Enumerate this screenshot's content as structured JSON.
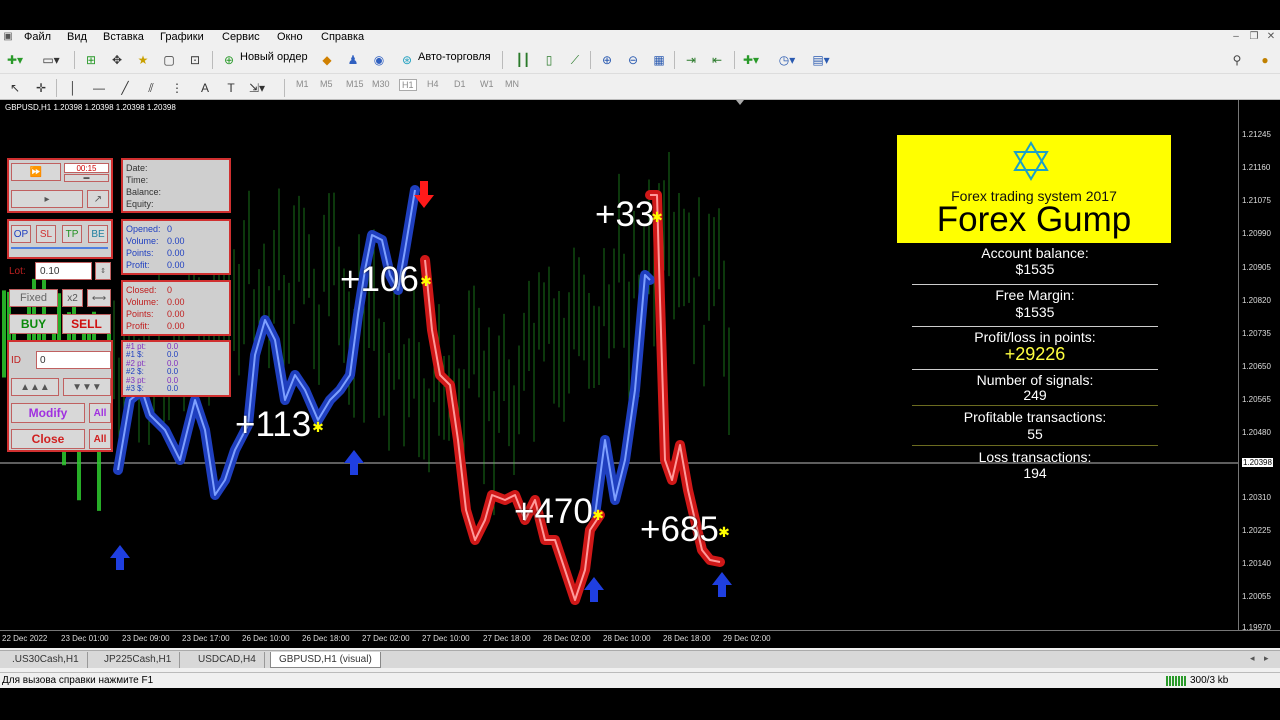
{
  "menu": [
    "Файл",
    "Вид",
    "Вставка",
    "Графики",
    "Сервис",
    "Окно",
    "Справка"
  ],
  "toolbar": {
    "new_order": "Новый ордер",
    "auto_trading": "Авто-торговля",
    "timeframes": [
      "M1",
      "M5",
      "M15",
      "M30",
      "H1",
      "H4",
      "D1",
      "W1",
      "MN"
    ]
  },
  "chart": {
    "header": "GBPUSD,H1  1.20398 1.20398 1.20398 1.20398",
    "price_scale": [
      "1.21245",
      "1.21160",
      "1.21075",
      "1.20990",
      "1.20905",
      "1.20820",
      "1.20735",
      "1.20650",
      "1.20565",
      "1.20480",
      "1.20398",
      "1.20310",
      "1.20225",
      "1.20140",
      "1.20055",
      "1.19970"
    ],
    "current_price": "1.20398",
    "time_labels": [
      "22 Dec 2022",
      "23 Dec 01:00",
      "23 Dec 09:00",
      "23 Dec 17:00",
      "26 Dec 10:00",
      "26 Dec 18:00",
      "27 Dec 02:00",
      "27 Dec 10:00",
      "27 Dec 18:00",
      "28 Dec 02:00",
      "28 Dec 10:00",
      "28 Dec 18:00",
      "29 Dec 02:00"
    ],
    "profit_labels": [
      "+106",
      "+113",
      "+33",
      "+470",
      "+685"
    ]
  },
  "panel": {
    "speed": "00:15",
    "info_labels": [
      "Date:",
      "Time:",
      "Balance:",
      "Equity:"
    ],
    "op_buttons": [
      "OP",
      "SL",
      "TP",
      "BE"
    ],
    "lot_label": "Lot:",
    "lot_value": "0.10",
    "fixed": "Fixed",
    "x2": "x2",
    "buy": "BUY",
    "sell": "SELL",
    "opened": [
      "Opened:",
      "Volume:",
      "Points:",
      "Profit:"
    ],
    "opened_vals": [
      "0",
      "0.00",
      "0.00",
      "0.00"
    ],
    "closed": [
      "Closed:",
      "Volume:",
      "Points:",
      "Profit:"
    ],
    "closed_vals": [
      "0",
      "0.00",
      "0.00",
      "0.00"
    ],
    "pts_labels": [
      "#1 pt:",
      "#1 $:",
      "#2 pt:",
      "#2 $:",
      "#3 pt:",
      "#3 $:"
    ],
    "pts_vals": [
      "0.0",
      "0.0",
      "0.0",
      "0.0",
      "0.0",
      "0.0"
    ],
    "id_label": "ID",
    "id_value": "0",
    "modify": "Modify",
    "close": "Close",
    "all": "All"
  },
  "gump": {
    "subtitle": "Forex trading system 2017",
    "title": "Forex Gump",
    "stats": [
      {
        "label": "Account balance:",
        "value": "$1535"
      },
      {
        "label": "Free Margin:",
        "value": "$1535"
      },
      {
        "label": "Profit/loss in points:",
        "value": "+29226"
      },
      {
        "label": "Number of signals:",
        "value": "249"
      },
      {
        "label": "Profitable transactions:",
        "value": "55"
      },
      {
        "label": "Loss transactions:",
        "value": "194"
      }
    ]
  },
  "tabs": [
    ".US30Cash,H1",
    "JP225Cash,H1",
    "USDCAD,H4",
    "GBPUSD,H1 (visual)"
  ],
  "status": {
    "help": "Для вызова справки нажмите F1",
    "traffic": "300/3 kb"
  },
  "colors": {
    "buy_line": "#1f3fbf",
    "sell_line": "#e02020",
    "banner": "#ffff00",
    "candle": "#2ecc2e"
  }
}
